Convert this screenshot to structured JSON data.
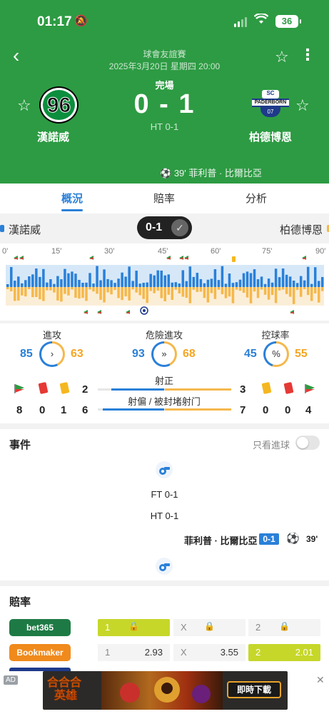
{
  "status_bar": {
    "time": "01:17",
    "battery": "36"
  },
  "header": {
    "league": "球會友誼賽",
    "kickoff": "2025年3月20日 星期四 20:00",
    "home_team": "漢諾威",
    "away_team": "柏德博恩",
    "home_logo_text": "96",
    "away_logo_top": "SC",
    "away_logo_mid": "PADERBORN",
    "away_logo_bot": "07",
    "match_status": "完場",
    "score": "0 - 1",
    "halftime": "HT 0-1",
    "goal_summary": "39' 菲利普 · 比爾比亞"
  },
  "tabs": [
    "概況",
    "賠率",
    "分析"
  ],
  "timeline": {
    "home_team": "漢諾威",
    "away_team": "柏德博恩",
    "score": "0-1",
    "minute_labels": [
      "0'",
      "15'",
      "30'",
      "45'",
      "60'",
      "75'",
      "90'"
    ]
  },
  "stats": {
    "attack": {
      "label": "進攻",
      "home": "85",
      "away": "63"
    },
    "dangerous_attack": {
      "label": "危險進攻",
      "home": "93",
      "away": "68"
    },
    "possession": {
      "label": "控球率",
      "home": "45",
      "away": "55"
    },
    "shots_on_target": {
      "label": "射正",
      "home": "2",
      "away": "3",
      "home_share": 0.4
    },
    "shots_off_blocked": {
      "label": "射偏 / 被封堵射门",
      "home": "6",
      "away": "7",
      "home_share": 0.46
    },
    "home_counts": {
      "corners": "8",
      "red_cards": "0",
      "yellow_cards": "1"
    },
    "away_counts": {
      "yellow_cards": "0",
      "red_cards": "0",
      "corners": "4"
    }
  },
  "events": {
    "title": "事件",
    "only_goals_label": "只看進球",
    "full_time": "FT 0-1",
    "half_time": "HT 0-1",
    "goal": {
      "player": "菲利普 · 比爾比亞",
      "score": "0-1",
      "minute": "39'"
    }
  },
  "odds": {
    "title": "賠率",
    "rows": [
      {
        "book": "bet365",
        "color": "#1e7a45",
        "h_key": "1",
        "h_val": "",
        "d_key": "X",
        "d_val": "",
        "a_key": "2",
        "a_val": "",
        "locked": true
      },
      {
        "book": "Bookmaker",
        "color": "#f08a1c",
        "h_key": "1",
        "h_val": "2.93",
        "d_key": "X",
        "d_val": "3.55",
        "a_key": "2",
        "a_val": "2.01",
        "locked": false
      }
    ]
  },
  "ad": {
    "tag": "AD",
    "left_text_1": "合合合",
    "left_text_2": "英雄",
    "button": "即時下載"
  },
  "colors": {
    "header_green": "#2d9b43",
    "home_blue": "#2a80d8",
    "away_orange": "#f5b84c",
    "highlight": "#c6d72a"
  }
}
